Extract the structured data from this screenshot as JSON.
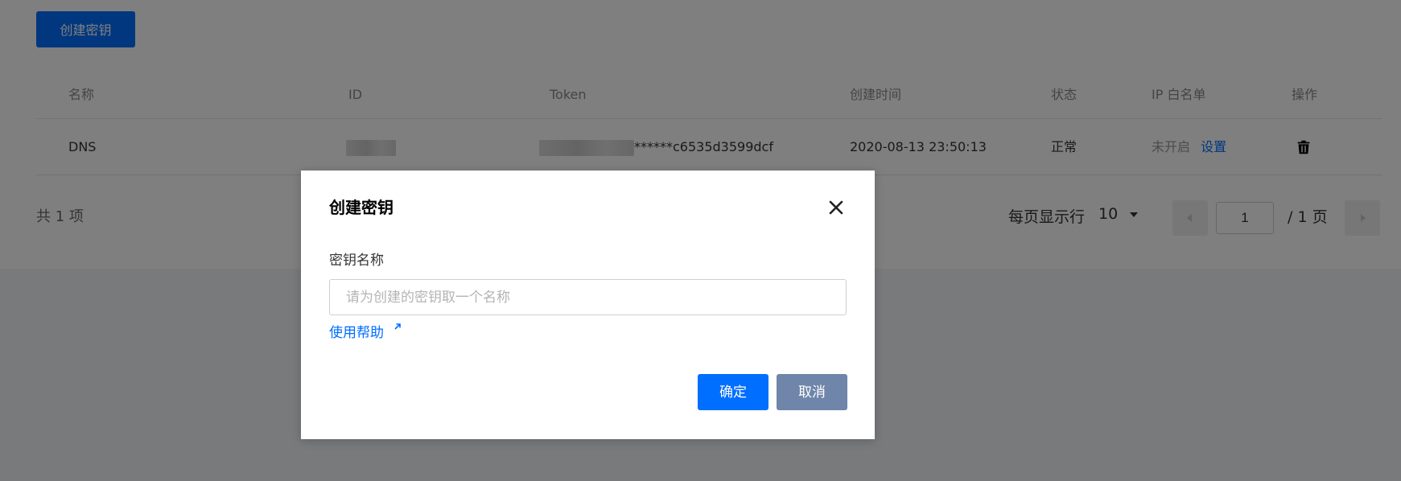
{
  "toolbar": {
    "create_label": "创建密钥"
  },
  "table": {
    "columns": [
      "名称",
      "ID",
      "Token",
      "创建时间",
      "状态",
      "IP 白名单",
      "操作"
    ],
    "rows": [
      {
        "name": "DNS",
        "id": "",
        "token_suffix": "******c6535d3599dcf",
        "created": "2020-08-13 23:50:13",
        "status": "正常",
        "ip_status": "未开启",
        "ip_action": "设置",
        "action_icon": "trash-icon"
      }
    ]
  },
  "pager": {
    "total": "共 1 项",
    "page_size_label": "每页显示行",
    "page_size": "10",
    "current_page": "1",
    "pages": "/ 1 页"
  },
  "modal": {
    "title": "创建密钥",
    "field_label": "密钥名称",
    "placeholder": "请为创建的密钥取一个名称",
    "value": "",
    "help_link": "使用帮助",
    "ok_label": "确定",
    "cancel_label": "取消"
  },
  "colors": {
    "primary": "#006eff",
    "cancel": "#6f85a9",
    "overlay": "rgba(0,0,0,0.5)"
  }
}
